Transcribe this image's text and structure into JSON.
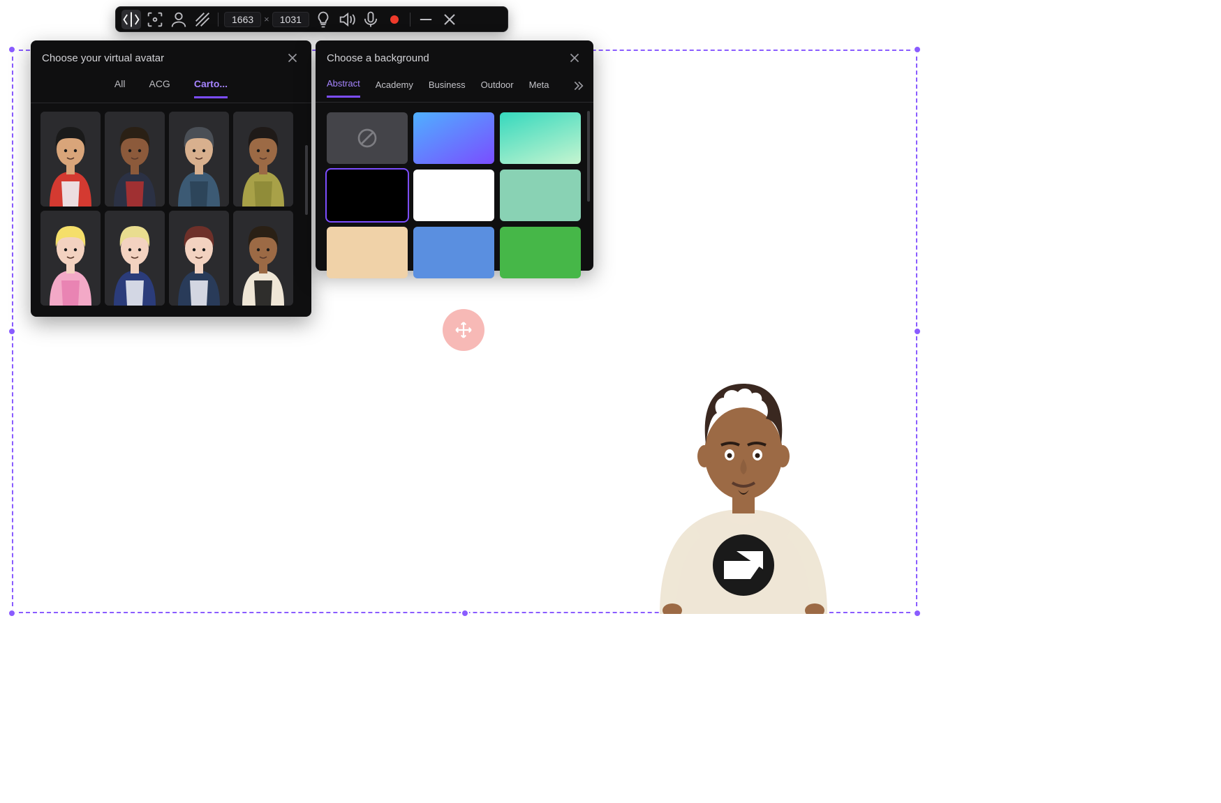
{
  "toolbar": {
    "width": "1663",
    "height": "1031"
  },
  "avatar_panel": {
    "title": "Choose your virtual avatar",
    "tabs": {
      "all": "All",
      "acg": "ACG",
      "cartoon": "Carto..."
    },
    "active_tab": "cartoon",
    "thumbs": [
      {
        "hair": "#1a1a1a",
        "skin": "#d9a57a",
        "top": "#d43a31",
        "accent": "#eef0f4"
      },
      {
        "hair": "#2a2015",
        "skin": "#8c5a3b",
        "top": "#2b3144",
        "accent": "#ad3131"
      },
      {
        "hair": "#4a4f56",
        "skin": "#d8b08e",
        "top": "#3c5a74",
        "accent": "#2b4258"
      },
      {
        "hair": "#1f1a18",
        "skin": "#9c6a45",
        "top": "#a8a148",
        "accent": "#8d8937"
      },
      {
        "hair": "#f5df6a",
        "skin": "#f3d2c0",
        "top": "#f3a9c7",
        "accent": "#e880b0"
      },
      {
        "hair": "#e9dd8f",
        "skin": "#f3d2c0",
        "top": "#2b3c7a",
        "accent": "#e6e8ef"
      },
      {
        "hair": "#6e3029",
        "skin": "#f3d2c0",
        "top": "#293b59",
        "accent": "#e6e8ef"
      },
      {
        "hair": "#2a2015",
        "skin": "#9c6a45",
        "top": "#efe6d6",
        "accent": "#1a1a1a"
      }
    ]
  },
  "bg_panel": {
    "title": "Choose a background",
    "tabs": {
      "abstract": "Abstract",
      "academy": "Academy",
      "business": "Business",
      "outdoor": "Outdoor",
      "meta": "Meta"
    },
    "active_tab": "abstract",
    "swatches": [
      {
        "css": "none"
      },
      {
        "css": "linear-gradient(150deg,#4fb0ff 0%,#7a4dff 100%)"
      },
      {
        "css": "linear-gradient(160deg,#35d8bd 0%,#c6f5d0 100%)"
      },
      {
        "css": "#000000",
        "selected": true
      },
      {
        "css": "#ffffff"
      },
      {
        "css": "#89d2b4"
      },
      {
        "css": "#f0d2a8"
      },
      {
        "css": "#5a8fe0"
      },
      {
        "css": "#46b748"
      }
    ]
  },
  "stage_avatar": {
    "hair": "#3a2820",
    "skin": "#9c6a45",
    "top": "#efe6d6",
    "accent": "#1a1a1a"
  }
}
